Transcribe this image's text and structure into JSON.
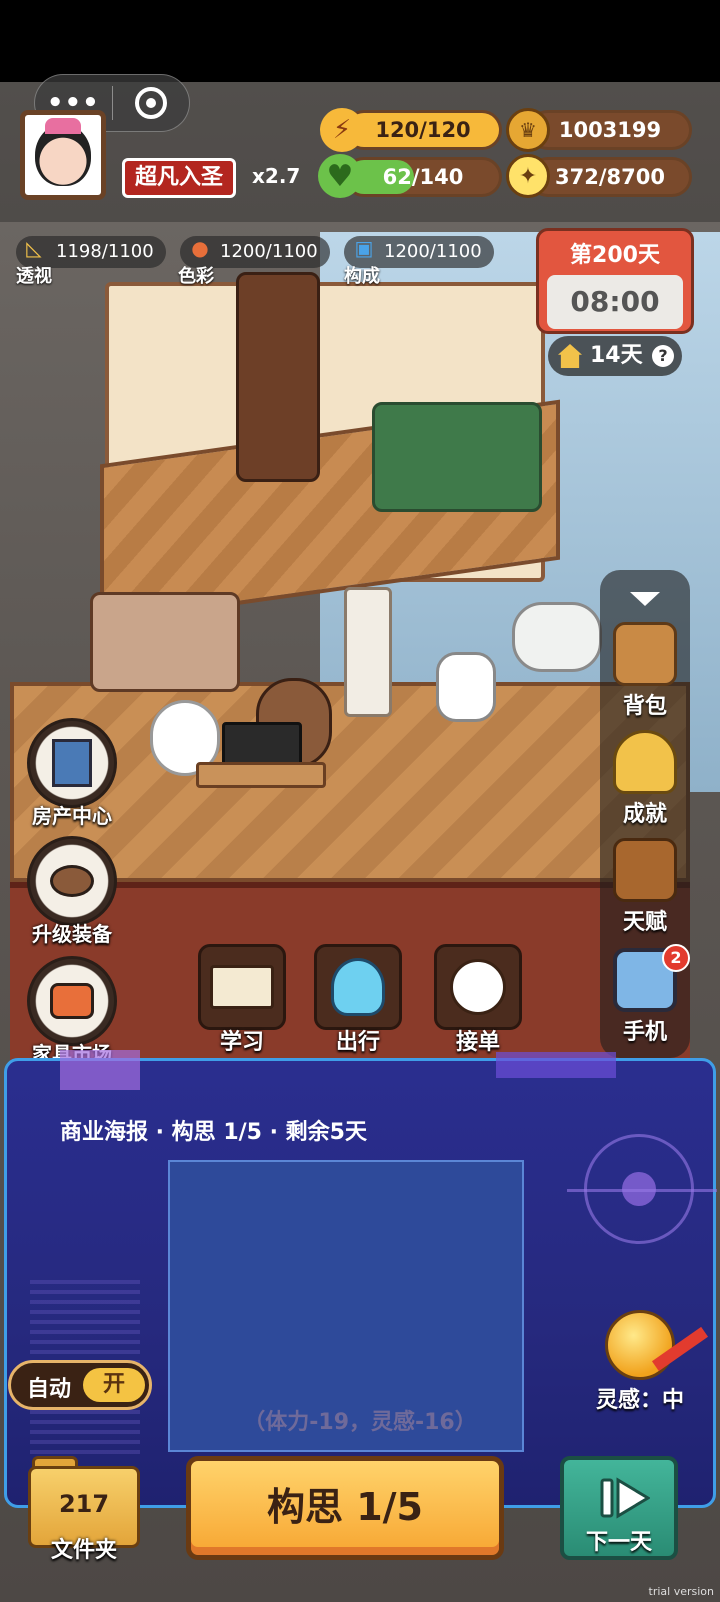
{
  "top_bar": {
    "capsule_more": "•••",
    "rank": "超凡入圣",
    "multiplier": "x2.7"
  },
  "stats": {
    "energy": {
      "text": "120/120",
      "fraction": 1.0
    },
    "coins": {
      "text": "1003199"
    },
    "health": {
      "text": "62/140",
      "fraction": 0.44
    },
    "inspiration_points": {
      "text": "372/8700"
    }
  },
  "skills": [
    {
      "value": "1198/1100",
      "label": "透视",
      "icon": "triangle-ruler-icon"
    },
    {
      "value": "1200/1100",
      "label": "色彩",
      "icon": "palette-icon"
    },
    {
      "value": "1200/1100",
      "label": "构成",
      "icon": "camera-icon"
    }
  ],
  "calendar": {
    "day": "第200天",
    "time": "08:00"
  },
  "days_left": {
    "text": "14天",
    "help": "?"
  },
  "side_menu": [
    {
      "label": "背包",
      "icon": "backpack-icon"
    },
    {
      "label": "成就",
      "icon": "trophy-icon"
    },
    {
      "label": "天赋",
      "icon": "talent-book-icon"
    },
    {
      "label": "手机",
      "icon": "phone-icon",
      "badge": "2"
    }
  ],
  "left_menu": [
    {
      "label": "房产中心",
      "icon": "building-icon"
    },
    {
      "label": "升级装备",
      "icon": "brush-palette-icon"
    },
    {
      "label": "家具市场",
      "icon": "tv-furniture-icon"
    }
  ],
  "actions": [
    {
      "label": "学习",
      "icon": "book-icon"
    },
    {
      "label": "出行",
      "icon": "ghost-icon"
    },
    {
      "label": "接单",
      "icon": "rabbit-icon"
    }
  ],
  "task": {
    "title": "商业海报 · 构思 1/5 · 剩余5天",
    "cost": "（体力-19，灵感-16）",
    "main_button": "构思 1/5"
  },
  "auto": {
    "label": "自动",
    "state": "开"
  },
  "inspiration": {
    "label": "灵感：中"
  },
  "folder": {
    "count": "217",
    "label": "文件夹"
  },
  "next_day": {
    "label": "下一天"
  },
  "watermark": "trial version",
  "colors": {
    "energy_fill": "#f7b93a",
    "health_fill": "#6cc24a",
    "panel_border": "#3f9ee8",
    "main_button": "#f7a632"
  }
}
